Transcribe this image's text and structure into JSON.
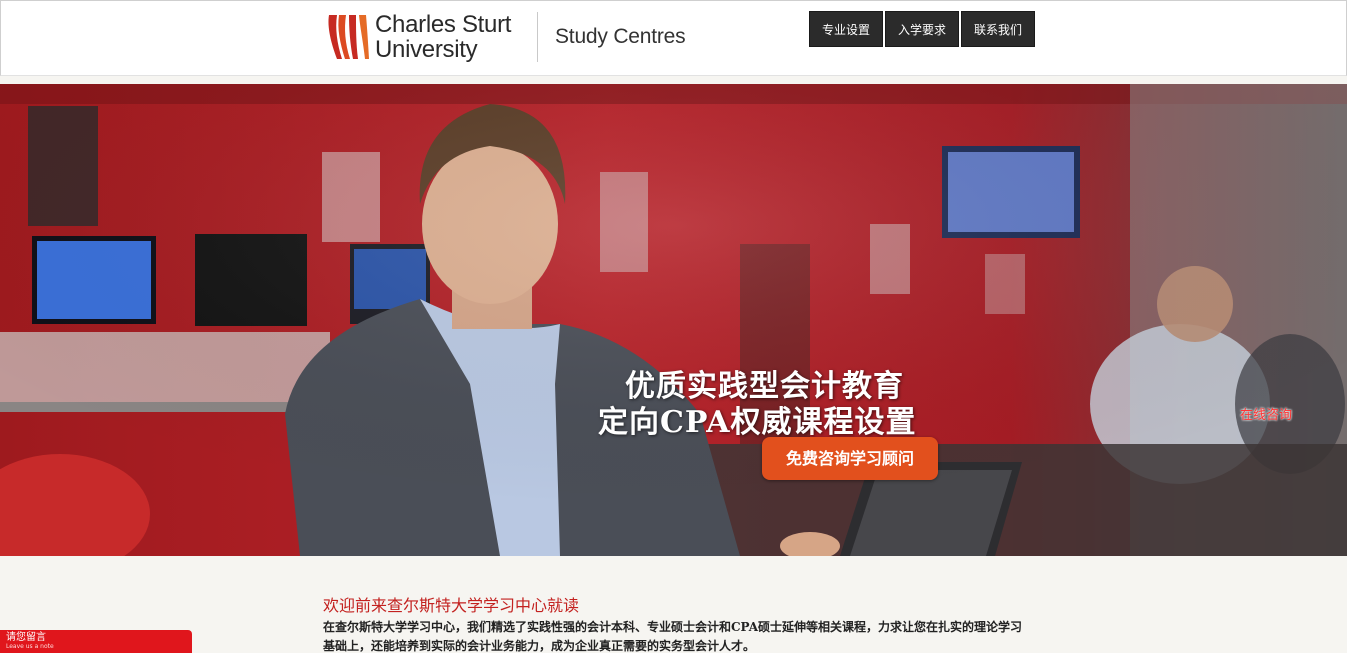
{
  "header": {
    "logo_line1": "Charles Sturt",
    "logo_line2": "University",
    "subtitle": "Study Centres"
  },
  "nav": {
    "items": [
      {
        "label": "专业设置"
      },
      {
        "label": "入学要求"
      },
      {
        "label": "联系我们"
      }
    ]
  },
  "hero": {
    "headline_line1": "优质实践型会计教育",
    "headline_line2": "定向CPA权威课程设置",
    "cta_label": "免费咨询学习顾问",
    "online_chat": "在线咨询"
  },
  "intro": {
    "title": "欢迎前来查尔斯特大学学习中心就读",
    "body": "在查尔斯特大学学习中心，我们精选了实践性强的会计本科、专业硕士会计和CPA硕士延伸等相关课程，力求让您在扎实的理论学习基础上，还能培养到实际的会计业务能力，成为企业真正需要的实务型会计人才。"
  },
  "note_tab": {
    "label": "请您留言",
    "sublabel": "Leave us a note"
  },
  "colors": {
    "brand_red": "#c3211f",
    "cta_orange": "#e2501d",
    "nav_dark": "#2b2b2b"
  }
}
